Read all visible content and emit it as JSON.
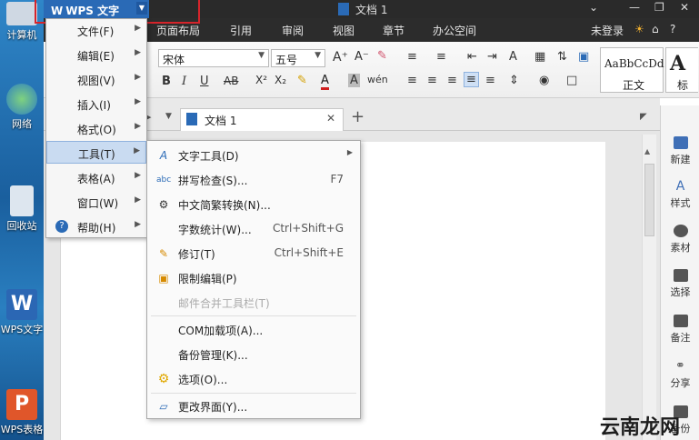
{
  "desktop": {
    "icons": [
      {
        "label": "计算机"
      },
      {
        "label": "网络"
      },
      {
        "label": "回收站"
      },
      {
        "label": "WPS文字"
      },
      {
        "label": "WPS表格"
      }
    ]
  },
  "window": {
    "app_button_label": "WPS 文字",
    "title": "文档 1",
    "login_label": "未登录",
    "help_label": "?"
  },
  "menu_tabs": [
    "页面布局",
    "引用",
    "审阅",
    "视图",
    "章节",
    "办公空间"
  ],
  "ribbon": {
    "font_name": "宋体",
    "font_size": "五号",
    "style_sample_1": "AaBbCcDd",
    "style_label_1": "正文",
    "style_sample_2": "A",
    "style_label_2": "标"
  },
  "doc_tab": {
    "title": "文档 1"
  },
  "main_menu": [
    {
      "label": "文件(F)"
    },
    {
      "label": "编辑(E)"
    },
    {
      "label": "视图(V)"
    },
    {
      "label": "插入(I)"
    },
    {
      "label": "格式(O)"
    },
    {
      "label": "工具(T)"
    },
    {
      "label": "表格(A)"
    },
    {
      "label": "窗口(W)"
    },
    {
      "label": "帮助(H)"
    }
  ],
  "tools_submenu": [
    {
      "label": "文字工具(D)",
      "shortcut": ""
    },
    {
      "label": "拼写检查(S)...",
      "shortcut": "F7"
    },
    {
      "label": "中文简繁转换(N)...",
      "shortcut": ""
    },
    {
      "label": "字数统计(W)...",
      "shortcut": "Ctrl+Shift+G"
    },
    {
      "label": "修订(T)",
      "shortcut": "Ctrl+Shift+E"
    },
    {
      "label": "限制编辑(P)",
      "shortcut": ""
    },
    {
      "label": "邮件合并工具栏(T)",
      "shortcut": ""
    },
    {
      "label": "COM加载项(A)...",
      "shortcut": ""
    },
    {
      "label": "备份管理(K)...",
      "shortcut": ""
    },
    {
      "label": "选项(O)...",
      "shortcut": ""
    },
    {
      "label": "更改界面(Y)...",
      "shortcut": ""
    }
  ],
  "right_panel": [
    {
      "label": "新建"
    },
    {
      "label": "样式"
    },
    {
      "label": "素材"
    },
    {
      "label": "选择"
    },
    {
      "label": "备注"
    },
    {
      "label": "分享"
    },
    {
      "label": "备份"
    }
  ],
  "watermark": {
    "text": "云南龙网"
  },
  "colors": {
    "accent": "#2a6ab6",
    "highlight_border": "#d6242b",
    "selected_item": "#c9dbf1",
    "dark_bar": "#2a2a2a"
  }
}
